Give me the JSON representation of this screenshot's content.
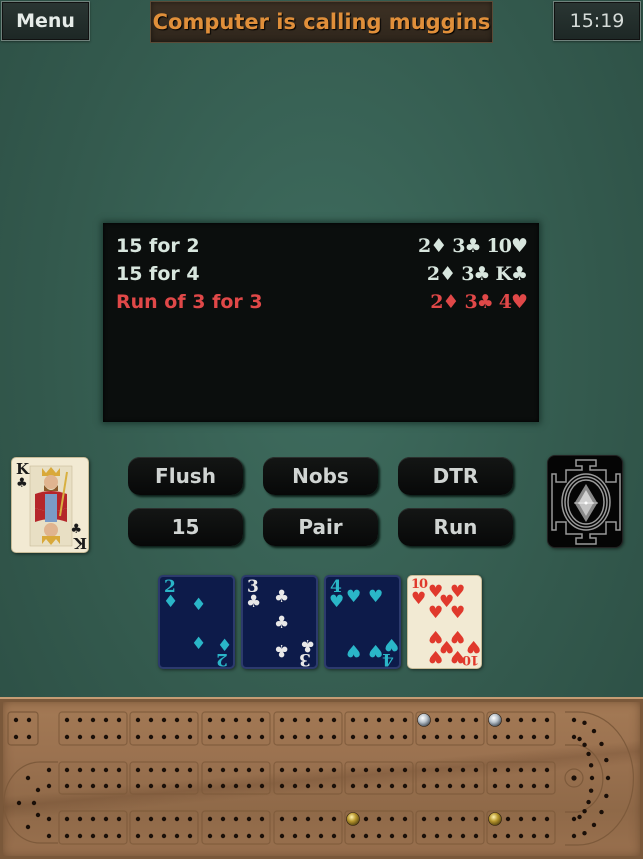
{
  "top_bar": {
    "menu_label": "Menu",
    "status_message": "Computer is calling muggins",
    "clock": "15:19"
  },
  "score_panel": {
    "rows": [
      {
        "label": "15 for 2",
        "cards": [
          "2♦",
          "3♣",
          "10♥"
        ],
        "highlighted": false
      },
      {
        "label": "15 for 4",
        "cards": [
          "2♦",
          "3♣",
          "K♣"
        ],
        "highlighted": false
      },
      {
        "label": "Run of 3 for 3",
        "cards": [
          "2♦",
          "3♣",
          "4♥"
        ],
        "highlighted": true
      }
    ]
  },
  "actions": [
    {
      "label": "Flush"
    },
    {
      "label": "Nobs"
    },
    {
      "label": "DTR"
    },
    {
      "label": "15"
    },
    {
      "label": "Pair"
    },
    {
      "label": "Run"
    }
  ],
  "starter_card": {
    "rank": "K",
    "suit": "♣"
  },
  "deck_back": {
    "design": "sri-yantra"
  },
  "hand": [
    {
      "rank": "2",
      "suit": "♦",
      "style": "selected"
    },
    {
      "rank": "3",
      "suit": "♣",
      "style": "selected"
    },
    {
      "rank": "4",
      "suit": "♥",
      "style": "selected"
    },
    {
      "rank": "10",
      "suit": "♥",
      "style": "normal"
    }
  ],
  "colors": {
    "status_text": "#e08f3a",
    "highlight_red": "#e04848",
    "selected_card_pip": "#29b6c8",
    "felt": "#33594d"
  },
  "board": {
    "pegs": [
      {
        "color": "silver",
        "track": 1,
        "hole": 26
      },
      {
        "color": "silver",
        "track": 1,
        "hole": 31
      },
      {
        "color": "gold",
        "track": 3,
        "hole": 21
      },
      {
        "color": "gold",
        "track": 3,
        "hole": 36
      }
    ]
  }
}
